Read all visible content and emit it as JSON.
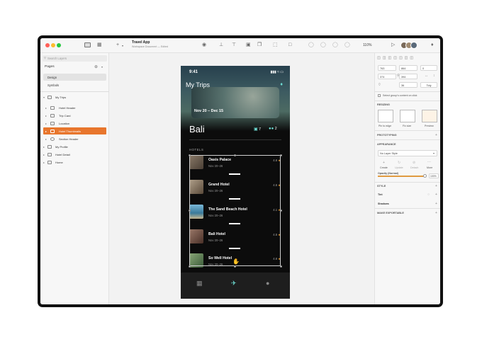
{
  "toolbar": {
    "doc_title": "Travel App",
    "doc_subtitle": "Workspace Document — Edited",
    "zoom": "110%",
    "add_icon": "plus-icon",
    "play_icon": "play-icon",
    "bell_icon": "bell-icon"
  },
  "sidebar": {
    "search_placeholder": "Search Layers",
    "pages_label": "Pages",
    "pages": [
      "Design",
      "Symbols"
    ],
    "layers": [
      {
        "label": "My Trips",
        "level": 0
      },
      {
        "label": "Hotel Header",
        "level": 1
      },
      {
        "label": "Trip Card",
        "level": 1
      },
      {
        "label": "Location",
        "level": 1
      },
      {
        "label": "Hotel Thumbnails",
        "level": 1,
        "selected": true
      },
      {
        "label": "Section Header",
        "level": 1
      },
      {
        "label": "My Profile",
        "level": 0
      },
      {
        "label": "Hotel Detail",
        "level": 0
      },
      {
        "label": "Home",
        "level": 0
      }
    ]
  },
  "phone": {
    "status_time": "9:41",
    "title": "My Trips",
    "dates": "Nov 20 – Dec 15",
    "city": "Bali",
    "hotels_count": "7",
    "people_count": "2",
    "section_label": "HOTELS",
    "hotels": [
      {
        "name": "Oasis Palace",
        "dates": "Nov 20–26",
        "rating": "4.6"
      },
      {
        "name": "Grand Hotel",
        "dates": "Nov 20–26",
        "rating": "4.5"
      },
      {
        "name": "The Sand Beach Hotel",
        "dates": "Nov 20–26",
        "rating": "4.1"
      },
      {
        "name": "Bali Hotel",
        "dates": "Nov 20–26",
        "rating": "4.5"
      },
      {
        "name": "So Well Hotel",
        "dates": "Nov 20–26",
        "rating": "4.6"
      }
    ]
  },
  "inspector": {
    "x": "763",
    "y": "864",
    "w": "374",
    "h": "394",
    "rotation": "0",
    "radius": "36",
    "tidy": "Tidy",
    "select_group_label": "Select group's content on click",
    "resizing_label": "RESIZING",
    "resize_options": [
      "Pin to edge",
      "Fix size",
      "Preview"
    ],
    "prototyping_label": "PROTOTYPING",
    "appearance_label": "APPEARANCE",
    "layer_style": "No Layer Style",
    "style_actions": [
      "Create",
      "Update",
      "Detach",
      "More"
    ],
    "opacity_label": "Opacity (Normal)",
    "opacity_value": "100%",
    "opacity_fraction": 1.0,
    "style_label": "STYLE",
    "tint_label": "Tint",
    "shadows_label": "Shadows",
    "export_label": "MAKE EXPORTABLE"
  },
  "colors": {
    "accent": "#e8762d",
    "teal": "#6fe2d8",
    "star": "#f0a030"
  }
}
